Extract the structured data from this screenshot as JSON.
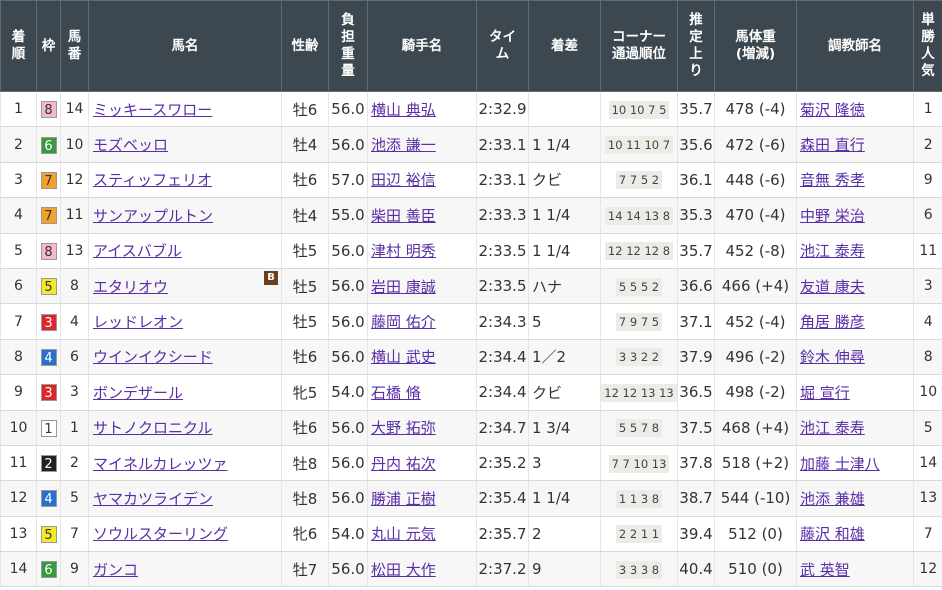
{
  "headers": {
    "rank": [
      "着",
      "順"
    ],
    "waku": [
      "枠"
    ],
    "num": [
      "馬",
      "番"
    ],
    "horse": [
      "馬名"
    ],
    "sexage": [
      "性齢"
    ],
    "weight": [
      "負",
      "担",
      "重",
      "量"
    ],
    "jockey": [
      "騎手名"
    ],
    "time": [
      "タイ",
      "ム"
    ],
    "margin": [
      "着差"
    ],
    "corner": [
      "コーナー",
      "通過順位"
    ],
    "last3f": [
      "推",
      "定",
      "上",
      "り"
    ],
    "body": [
      "馬体重",
      "(増減)"
    ],
    "trainer": [
      "調教師名"
    ],
    "pop": [
      "単",
      "勝",
      "人",
      "気"
    ]
  },
  "waku_colors": {
    "1": {
      "bg": "#ffffff",
      "fg": "#333333"
    },
    "2": {
      "bg": "#222222",
      "fg": "#ffffff"
    },
    "3": {
      "bg": "#d9272d",
      "fg": "#ffffff"
    },
    "4": {
      "bg": "#2a6fce",
      "fg": "#ffffff"
    },
    "5": {
      "bg": "#f5ea2a",
      "fg": "#333333"
    },
    "6": {
      "bg": "#3a9a3e",
      "fg": "#ffffff"
    },
    "7": {
      "bg": "#f2a12b",
      "fg": "#333333"
    },
    "8": {
      "bg": "#f7b8cc",
      "fg": "#333333"
    }
  },
  "rows": [
    {
      "rank": "1",
      "waku": "8",
      "num": "14",
      "horse": "ミッキースワロー",
      "blinker": "",
      "sex_age": "牡6",
      "weight": "56.0",
      "jockey": "横山 典弘",
      "time": "2:32.9",
      "margin": "",
      "corner": "10 10 7 5",
      "last3f": "35.7",
      "body": "478 (-4)",
      "trainer": "菊沢 隆徳",
      "pop": "1"
    },
    {
      "rank": "2",
      "waku": "6",
      "num": "10",
      "horse": "モズベッロ",
      "blinker": "",
      "sex_age": "牡4",
      "weight": "56.0",
      "jockey": "池添 謙一",
      "time": "2:33.1",
      "margin": "1 1/4",
      "corner": "10 11 10 7",
      "last3f": "35.6",
      "body": "472 (-6)",
      "trainer": "森田 直行",
      "pop": "2"
    },
    {
      "rank": "3",
      "waku": "7",
      "num": "12",
      "horse": "スティッフェリオ",
      "blinker": "",
      "sex_age": "牡6",
      "weight": "57.0",
      "jockey": "田辺 裕信",
      "time": "2:33.1",
      "margin": "クビ",
      "corner": "7 7 5 2",
      "last3f": "36.1",
      "body": "448 (-6)",
      "trainer": "音無 秀孝",
      "pop": "9"
    },
    {
      "rank": "4",
      "waku": "7",
      "num": "11",
      "horse": "サンアップルトン",
      "blinker": "",
      "sex_age": "牡4",
      "weight": "55.0",
      "jockey": "柴田 善臣",
      "time": "2:33.3",
      "margin": "1 1/4",
      "corner": "14 14 13 8",
      "last3f": "35.3",
      "body": "470 (-4)",
      "trainer": "中野 栄治",
      "pop": "6"
    },
    {
      "rank": "5",
      "waku": "8",
      "num": "13",
      "horse": "アイスバブル",
      "blinker": "",
      "sex_age": "牡5",
      "weight": "56.0",
      "jockey": "津村 明秀",
      "time": "2:33.5",
      "margin": "1 1/4",
      "corner": "12 12 12 8",
      "last3f": "35.7",
      "body": "452 (-8)",
      "trainer": "池江 泰寿",
      "pop": "11"
    },
    {
      "rank": "6",
      "waku": "5",
      "num": "8",
      "horse": "エタリオウ",
      "blinker": "B",
      "sex_age": "牡5",
      "weight": "56.0",
      "jockey": "岩田 康誠",
      "time": "2:33.5",
      "margin": "ハナ",
      "corner": "5 5 5 2",
      "last3f": "36.6",
      "body": "466 (+4)",
      "trainer": "友道 康夫",
      "pop": "3"
    },
    {
      "rank": "7",
      "waku": "3",
      "num": "4",
      "horse": "レッドレオン",
      "blinker": "",
      "sex_age": "牡5",
      "weight": "56.0",
      "jockey": "藤岡 佑介",
      "time": "2:34.3",
      "margin": "5",
      "corner": "7 9 7 5",
      "last3f": "37.1",
      "body": "452 (-4)",
      "trainer": "角居 勝彦",
      "pop": "4"
    },
    {
      "rank": "8",
      "waku": "4",
      "num": "6",
      "horse": "ウインイクシード",
      "blinker": "",
      "sex_age": "牡6",
      "weight": "56.0",
      "jockey": "横山 武史",
      "time": "2:34.4",
      "margin": "1／2",
      "corner": "3 3 2 2",
      "last3f": "37.9",
      "body": "496 (-2)",
      "trainer": "鈴木 伸尋",
      "pop": "8"
    },
    {
      "rank": "9",
      "waku": "3",
      "num": "3",
      "horse": "ボンデザール",
      "blinker": "",
      "sex_age": "牝5",
      "weight": "54.0",
      "jockey": "石橋 脩",
      "time": "2:34.4",
      "margin": "クビ",
      "corner": "12 12 13 13",
      "last3f": "36.5",
      "body": "498 (-2)",
      "trainer": "堀 宣行",
      "pop": "10"
    },
    {
      "rank": "10",
      "waku": "1",
      "num": "1",
      "horse": "サトノクロニクル",
      "blinker": "",
      "sex_age": "牡6",
      "weight": "56.0",
      "jockey": "大野 拓弥",
      "time": "2:34.7",
      "margin": "1 3/4",
      "corner": "5 5 7 8",
      "last3f": "37.5",
      "body": "468 (+4)",
      "trainer": "池江 泰寿",
      "pop": "5"
    },
    {
      "rank": "11",
      "waku": "2",
      "num": "2",
      "horse": "マイネルカレッツァ",
      "blinker": "",
      "sex_age": "牡8",
      "weight": "56.0",
      "jockey": "丹内 祐次",
      "time": "2:35.2",
      "margin": "3",
      "corner": "7 7 10 13",
      "last3f": "37.8",
      "body": "518 (+2)",
      "trainer": "加藤 士津八",
      "pop": "14"
    },
    {
      "rank": "12",
      "waku": "4",
      "num": "5",
      "horse": "ヤマカツライデン",
      "blinker": "",
      "sex_age": "牡8",
      "weight": "56.0",
      "jockey": "勝浦 正樹",
      "time": "2:35.4",
      "margin": "1 1/4",
      "corner": "1 1 3 8",
      "last3f": "38.7",
      "body": "544 (-10)",
      "trainer": "池添 兼雄",
      "pop": "13"
    },
    {
      "rank": "13",
      "waku": "5",
      "num": "7",
      "horse": "ソウルスターリング",
      "blinker": "",
      "sex_age": "牝6",
      "weight": "54.0",
      "jockey": "丸山 元気",
      "time": "2:35.7",
      "margin": "2",
      "corner": "2 2 1 1",
      "last3f": "39.4",
      "body": "512 (0)",
      "trainer": "藤沢 和雄",
      "pop": "7"
    },
    {
      "rank": "14",
      "waku": "6",
      "num": "9",
      "horse": "ガンコ",
      "blinker": "",
      "sex_age": "牡7",
      "weight": "56.0",
      "jockey": "松田 大作",
      "time": "2:37.2",
      "margin": "9",
      "corner": "3 3 3 8",
      "last3f": "40.4",
      "body": "510 (0)",
      "trainer": "武 英智",
      "pop": "12"
    }
  ]
}
